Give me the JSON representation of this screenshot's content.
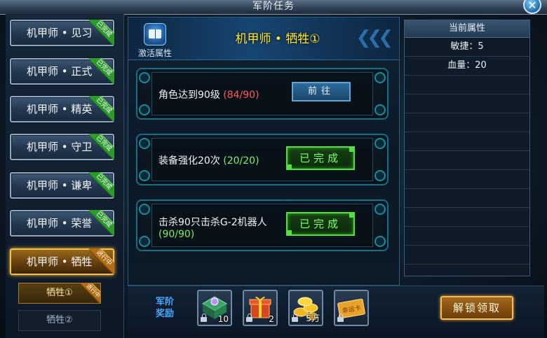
{
  "window": {
    "title": "军阶任务"
  },
  "ranks": [
    {
      "label": "机甲师 • 见习",
      "status": "已完成",
      "state": "done"
    },
    {
      "label": "机甲师 • 正式",
      "status": "已完成",
      "state": "done"
    },
    {
      "label": "机甲师 • 精英",
      "status": "已完成",
      "state": "done"
    },
    {
      "label": "机甲师 • 守卫",
      "status": "已完成",
      "state": "done"
    },
    {
      "label": "机甲师 • 谦卑",
      "status": "已完成",
      "state": "done"
    },
    {
      "label": "机甲师 • 荣誉",
      "status": "已完成",
      "state": "done"
    },
    {
      "label": "机甲师 • 牺牲",
      "status": "进行中",
      "state": "active"
    }
  ],
  "subtasks": [
    {
      "label": "牺牲①",
      "status": "进行中",
      "state": "active"
    },
    {
      "label": "牺牲②",
      "status": "",
      "state": "idle"
    }
  ],
  "header": {
    "icon_label": "激活属性",
    "title": "机甲师 • 牺牲①"
  },
  "tasks": [
    {
      "desc": "角色达到90级",
      "progress": "(84/90)",
      "complete": false,
      "button": "前往"
    },
    {
      "desc": "装备强化20次",
      "progress": "(20/20)",
      "complete": true,
      "button": "已完成"
    },
    {
      "desc": "击杀90只击杀G-2机器人",
      "progress": "(90/90)",
      "complete": true,
      "button": "已完成"
    }
  ],
  "attributes": {
    "heading": "当前属性",
    "rows": [
      "敏捷：5",
      "血量：20"
    ]
  },
  "rewards": {
    "label_line1": "军阶",
    "label_line2": "奖励",
    "items": [
      {
        "icon": "mech-core-icon",
        "count": "10"
      },
      {
        "icon": "gift-box-icon",
        "count": "2"
      },
      {
        "icon": "gold-coins-icon",
        "count": "5万"
      },
      {
        "icon": "lucky-card-icon",
        "count": "",
        "card_text": "幸运卡"
      }
    ]
  },
  "unlock_button": "解锁领取",
  "colors": {
    "complete": "#7cf06b",
    "incomplete": "#ff5a5a",
    "title": "#ffe32e",
    "done_ribbon": "#2d9a2e",
    "progress_ribbon": "#b36c12"
  }
}
